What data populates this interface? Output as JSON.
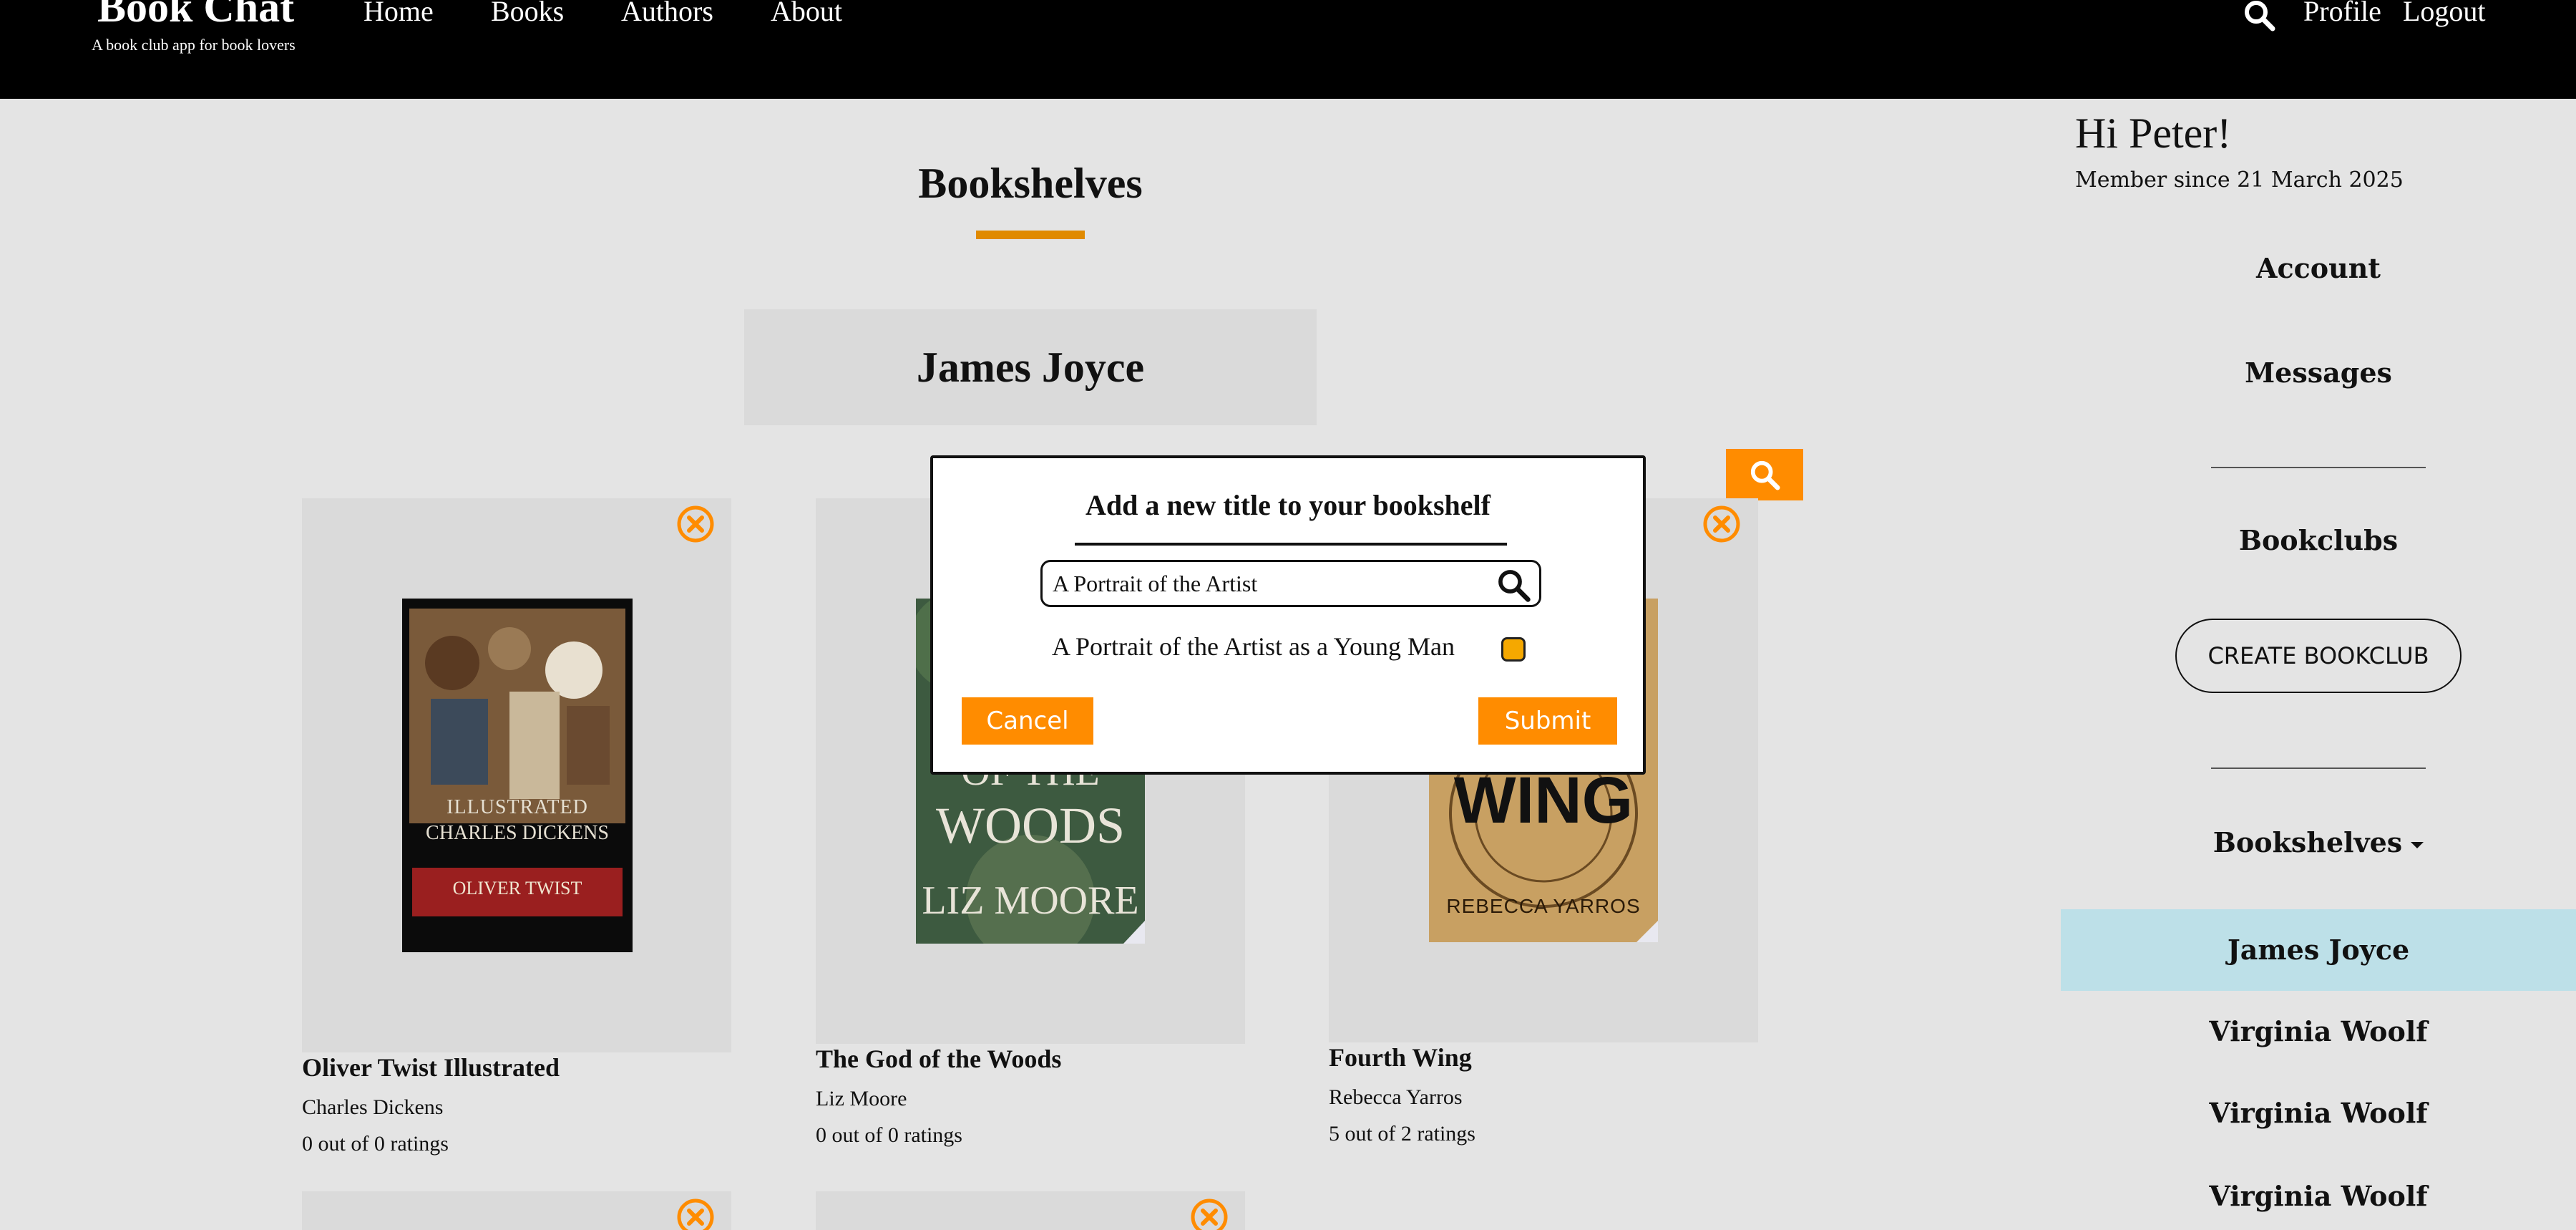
{
  "nav": {
    "brand_title": "Book Chat",
    "brand_tagline": "A book club app for book lovers",
    "links": [
      "Home",
      "Books",
      "Authors",
      "About"
    ],
    "profile_label": "Profile",
    "logout_label": "Logout",
    "search_icon": "search-icon"
  },
  "main": {
    "page_title": "Bookshelves",
    "shelf_name": "James Joyce",
    "accent_color": "#ff8c00",
    "books": [
      {
        "title": "Oliver Twist Illustrated",
        "author": "Charles Dickens",
        "rating": "0 out of 0 ratings",
        "cover_text": [
          "ILLUSTRATED",
          "CHARLES DICKENS",
          "OLIVER TWIST"
        ]
      },
      {
        "title": "The God of the Woods",
        "author": "Liz Moore",
        "rating": "0 out of 0 ratings",
        "cover_text": [
          "OF THE",
          "WOODS",
          "LIZ MOORE"
        ]
      },
      {
        "title": "Fourth Wing",
        "author": "Rebecca Yarros",
        "rating": "5 out of 2 ratings",
        "cover_text": [
          "WING",
          "REBECCA YARROS"
        ]
      }
    ]
  },
  "sidebar": {
    "greeting": "Hi Peter!",
    "member_since": "Member since 21 March 2025",
    "account_label": "Account",
    "messages_label": "Messages",
    "bookclubs_label": "Bookclubs",
    "create_bookclub_label": "CREATE BOOKCLUB",
    "bookshelves_label": "Bookshelves",
    "shelves": [
      "James Joyce",
      "Virginia Woolf",
      "Virginia Woolf",
      "Virginia Woolf"
    ],
    "active_color": "#bde0e8"
  },
  "modal": {
    "title": "Add a new title to your bookshelf",
    "search_value": "A Portrait of the Artist",
    "result": "A Portrait of the Artist as a Young Man",
    "cancel_label": "Cancel",
    "submit_label": "Submit"
  }
}
